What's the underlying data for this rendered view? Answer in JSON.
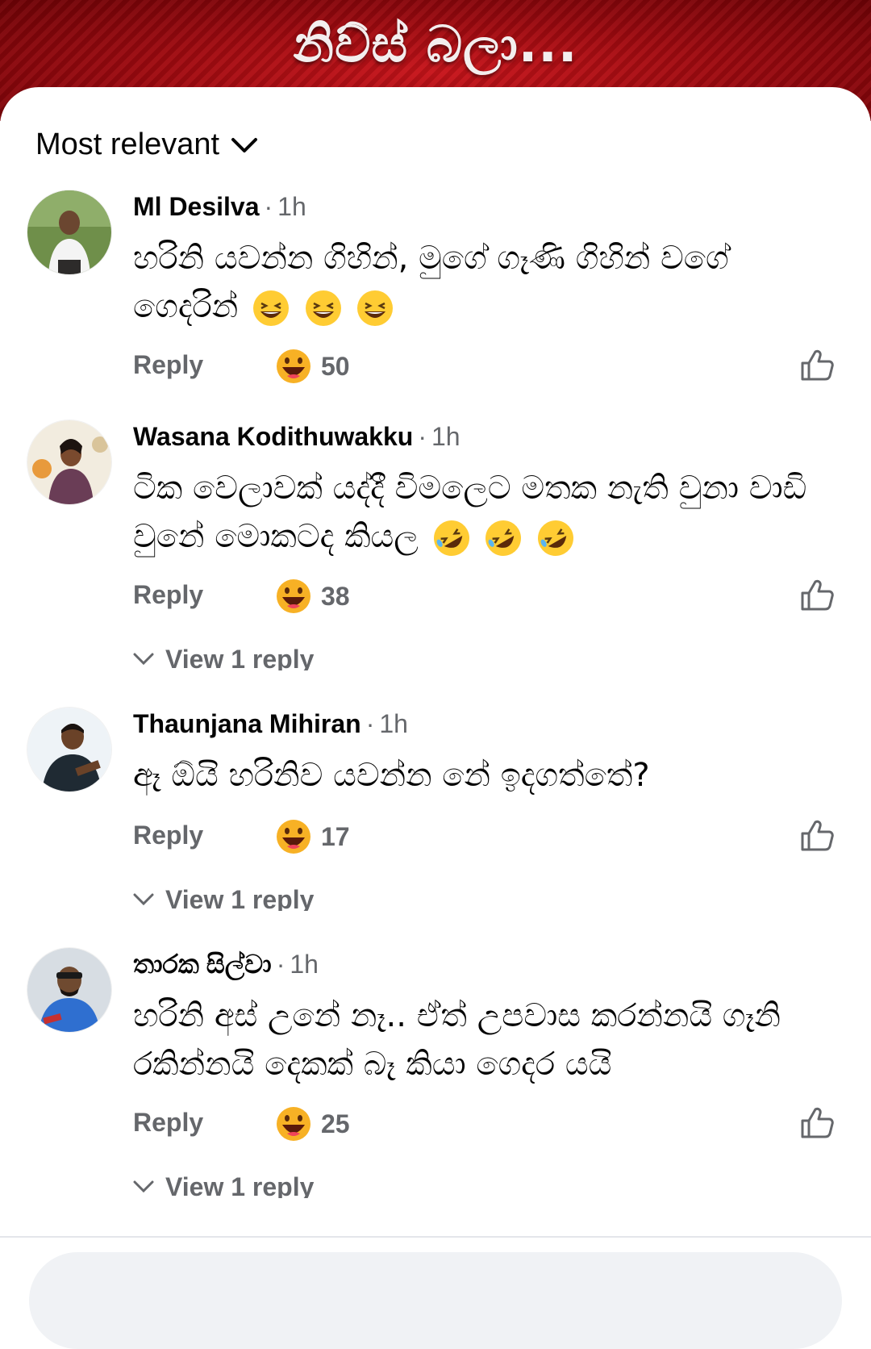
{
  "header": {
    "title": "නිව්ස් බලා..."
  },
  "sort": {
    "label": "Most relevant"
  },
  "comments": [
    {
      "author": "Ml Desilva",
      "time": "1h",
      "text": "හරිනි යවන්න ගිහින්, මුගේ ගෑණි ගිහින් වගේ ගෙදරින්",
      "text_emoji": "laughing-emoji",
      "reply_label": "Reply",
      "reaction_icon": "haha-reaction-icon",
      "reaction_count": "50",
      "view_replies": null
    },
    {
      "author": "Wasana Kodithuwakku",
      "time": "1h",
      "text": "ටික වෙලාවක් යද්දී විමලෙට මතක නැති වුනා වාඩි වුනේ මොකටද කියල",
      "text_emoji": "rolling-on-floor-laughing-emoji",
      "reply_label": "Reply",
      "reaction_icon": "haha-reaction-icon",
      "reaction_count": "38",
      "view_replies": "View 1 reply"
    },
    {
      "author": "Thaunjana Mihiran",
      "time": "1h",
      "text": "ඈ ඕයි හරිනිව යවන්න නේ ඉදගත්තේ?",
      "text_emoji": null,
      "reply_label": "Reply",
      "reaction_icon": "haha-reaction-icon",
      "reaction_count": "17",
      "view_replies": "View 1 reply"
    },
    {
      "author": "තාරක සිල්වා",
      "time": "1h",
      "text": "හරිනි අස් උනේ නෑ.. ඒත් උපවාස කරන්නයි ගෑනි රකින්නයි දෙකක් බෑ කියා  ගෙදර යයි",
      "text_emoji": null,
      "reply_label": "Reply",
      "reaction_icon": "haha-reaction-icon",
      "reaction_count": "25",
      "view_replies": "View 1 reply"
    }
  ],
  "colors": {
    "banner": "#a00a10",
    "secondary_text": "#65676b",
    "primary_text": "#050505",
    "reaction_yellow": "#f7b125"
  }
}
